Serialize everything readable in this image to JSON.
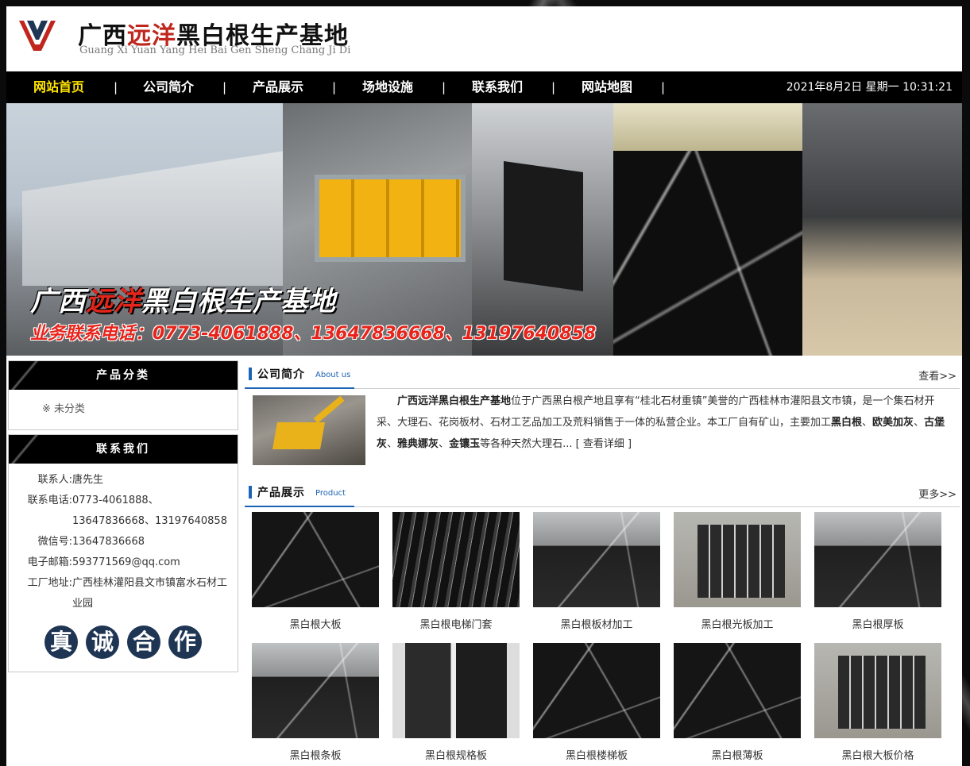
{
  "header": {
    "title_a": "广西",
    "title_red": "远洋",
    "title_b": "黑白根生产基地",
    "subtitle": "Guang Xi Yuan Yang Hei Bai Gen Sheng Chang Ji Di"
  },
  "nav": {
    "items": [
      {
        "label": "网站首页"
      },
      {
        "label": "公司简介"
      },
      {
        "label": "产品展示"
      },
      {
        "label": "场地设施"
      },
      {
        "label": "联系我们"
      },
      {
        "label": "网站地图"
      }
    ],
    "separator": "|",
    "datetime": "2021年8月2日 星期一 10:31:21"
  },
  "banner": {
    "title_a": "广西",
    "title_red": "远洋",
    "title_b": "黑白根生产基地",
    "phone": "业务联系电话：0773-4061888、13647836668、13197640858"
  },
  "sidebar": {
    "categories_title": "产品分类",
    "categories": [
      "※ 未分类"
    ],
    "contact_title": "联系我们",
    "contact": [
      {
        "k": "联系人:",
        "v": "唐先生"
      },
      {
        "k": "联系电话:",
        "v": "0773-4061888、13647836668、13197640858"
      },
      {
        "k": "微信号:",
        "v": "13647836668"
      },
      {
        "k": "电子邮箱:",
        "v": "593771569@qq.com"
      },
      {
        "k": "工厂地址:",
        "v": "广西桂林灌阳县文市镇富水石材工业园"
      }
    ],
    "seal": [
      "真",
      "诚",
      "合",
      "作"
    ]
  },
  "about": {
    "title": "公司简介",
    "title_en": "About us",
    "more": "查看>>",
    "company": "广西远洋黑白根生产基地",
    "text_1": "位于广西黑白根产地且享有“桂北石材重镇”美誉的广西桂林市灌阳县文市镇，是一个集石材开采、大理石、花岗板材、石材工艺品加工及荒料销售于一体的私营企业。本工厂自有矿山，主要加工",
    "b1": "黑白根",
    "s1": "、",
    "b2": "欧美加灰",
    "s2": "、",
    "b3": "古堡灰",
    "s3": "、",
    "b4": "雅典娜灰",
    "s4": "、",
    "b5": "金镶玉",
    "text_2": "等各种天然大理石...",
    "detail": " [ 查看详细 ]"
  },
  "products": {
    "title": "产品展示",
    "title_en": "Product",
    "more": "更多>>",
    "items": [
      {
        "name": "黑白根大板"
      },
      {
        "name": "黑白根电梯门套"
      },
      {
        "name": "黑白根板材加工"
      },
      {
        "name": "黑白根光板加工"
      },
      {
        "name": "黑白根厚板"
      },
      {
        "name": "黑白根条板"
      },
      {
        "name": "黑白根规格板"
      },
      {
        "name": "黑白根楼梯板"
      },
      {
        "name": "黑白根薄板"
      },
      {
        "name": "黑白根大板价格"
      }
    ]
  },
  "colors": {
    "nav_active": "#ffe400",
    "accent_blue": "#1b63b3",
    "brand_red": "#c0261d"
  }
}
